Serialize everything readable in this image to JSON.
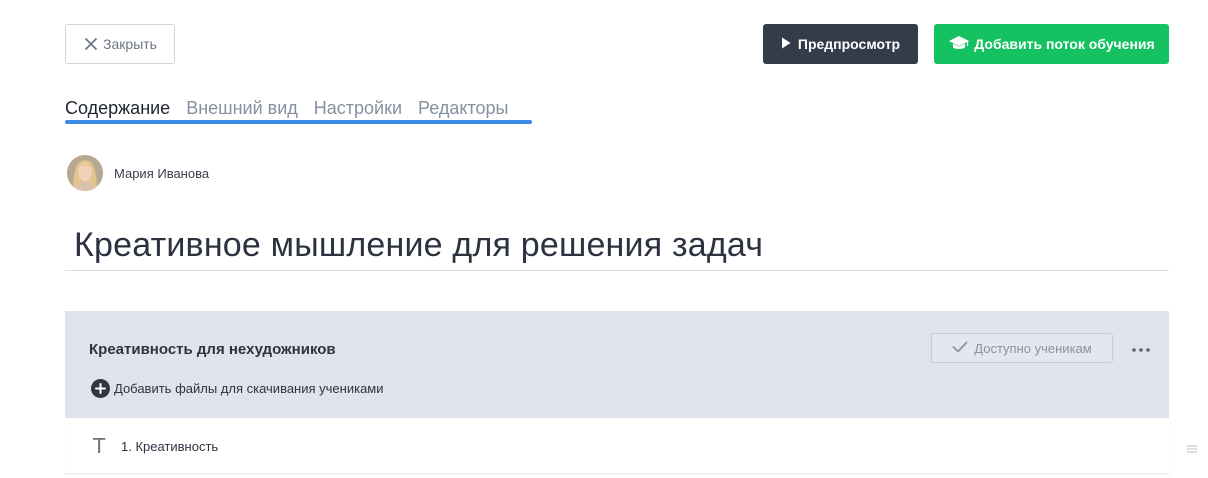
{
  "header": {
    "close_label": "Закрыть",
    "preview_label": "Предпросмотр",
    "add_stream_label": "Добавить поток обучения"
  },
  "tabs": [
    {
      "label": "Содержание",
      "active": true
    },
    {
      "label": "Внешний вид",
      "active": false
    },
    {
      "label": "Настройки",
      "active": false
    },
    {
      "label": "Редакторы",
      "active": false
    }
  ],
  "author": {
    "name": "Мария Иванова"
  },
  "course": {
    "title": "Креативное мышление для решения задач"
  },
  "module": {
    "title": "Креативность для нехудожников",
    "status_label": "Доступно ученикам",
    "add_files_label": "Добавить файлы для скачивания учениками"
  },
  "lessons": [
    {
      "title": "1. Креативность",
      "type_icon": "text-type-icon"
    }
  ],
  "colors": {
    "accent": "#3a8ae6",
    "preview_bg": "#343c4a",
    "primary_green": "#15c262",
    "module_bg": "#dfe4ec"
  }
}
